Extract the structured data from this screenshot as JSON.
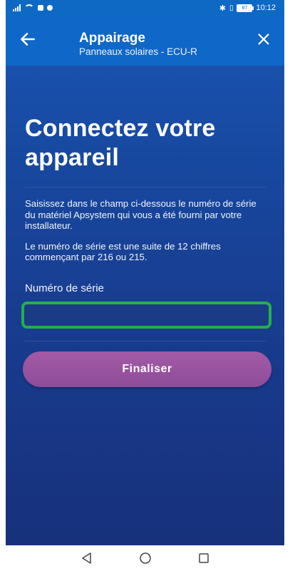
{
  "status_bar": {
    "time": "10:12",
    "battery": "87",
    "icons": [
      "signal-icon",
      "wifi-icon",
      "notification-icon",
      "message-icon",
      "bluetooth-icon",
      "vibrate-icon",
      "battery-icon"
    ]
  },
  "app_bar": {
    "title": "Appairage",
    "subtitle": "Panneaux solaires - ECU-R",
    "back_icon": "arrow-left-icon",
    "close_icon": "close-icon"
  },
  "main": {
    "headline": "Connectez votre appareil",
    "paragraph_1": "Saisissez dans le champ ci-dessous le numéro de série du matériel Apsystem qui vous a été fourni par votre installateur.",
    "paragraph_2": "Le numéro de série est une suite de 12 chiffres commençant par 216 ou 215.",
    "serial_label": "Numéro de série",
    "serial_value": "",
    "serial_placeholder": "",
    "submit_label": "Finaliser"
  },
  "colors": {
    "app_bar": "#0f67c8",
    "background_top": "#1a56b6",
    "background_bottom": "#17317c",
    "button": "#9a55a0",
    "input_highlight": "#22b14c"
  },
  "nav_bar": {
    "icons": [
      "back-triangle-icon",
      "home-circle-icon",
      "recents-square-icon"
    ]
  }
}
